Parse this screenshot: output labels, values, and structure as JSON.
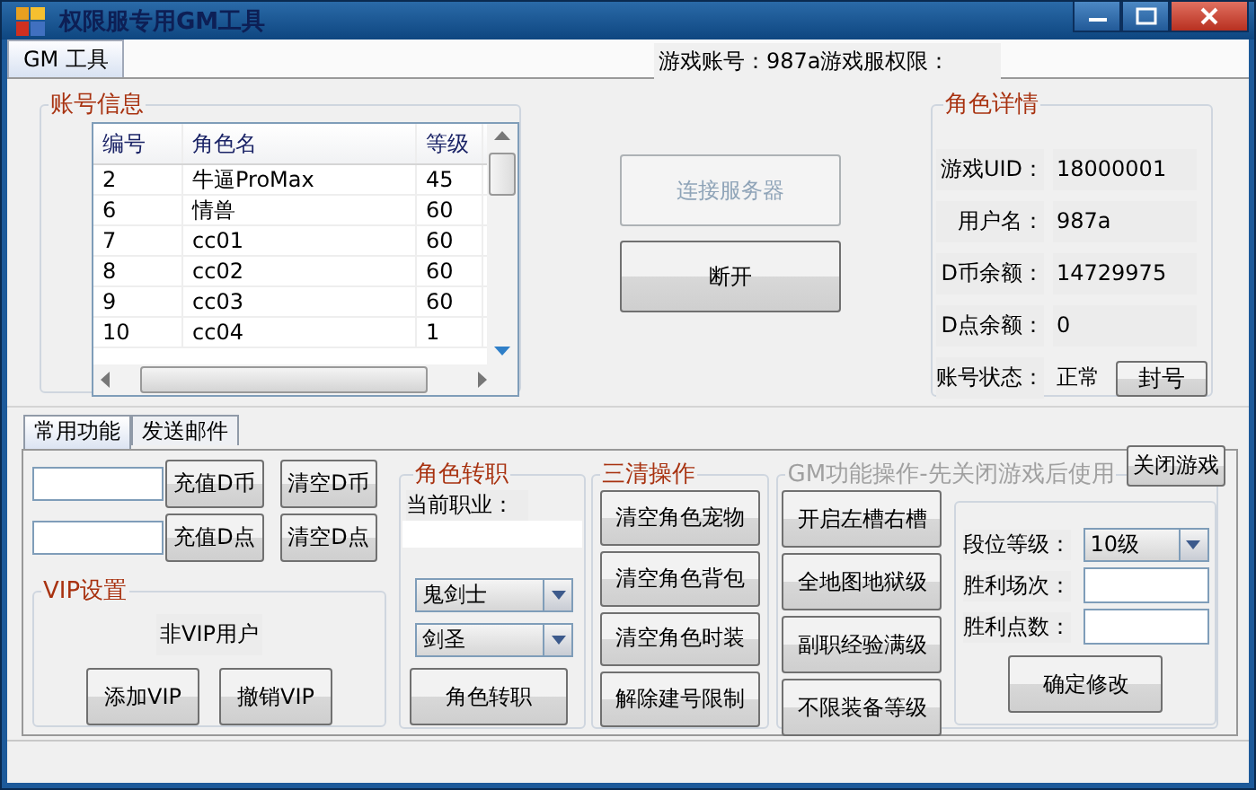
{
  "window": {
    "title": "权限服专用GM工具"
  },
  "menu": [
    {
      "label": "GM 工具",
      "selected": true
    }
  ],
  "header_info": "游戏账号：987a游戏服权限：",
  "account_info": {
    "title": "账号信息",
    "columns": [
      "编号",
      "角色名",
      "等级"
    ],
    "rows": [
      [
        "2",
        "牛逼ProMax",
        "45"
      ],
      [
        "6",
        "情兽",
        "60"
      ],
      [
        "7",
        "cc01",
        "60"
      ],
      [
        "8",
        "cc02",
        "60"
      ],
      [
        "9",
        "cc03",
        "60"
      ],
      [
        "10",
        "cc04",
        "1"
      ]
    ]
  },
  "connection_buttons": [
    {
      "label": "连接服务器",
      "disabled": true
    },
    {
      "label": "断开",
      "disabled": false
    }
  ],
  "role_details": {
    "title": "角色详情",
    "fields": [
      {
        "label": "游戏UID：",
        "value": "18000001"
      },
      {
        "label": "用户名：",
        "value": "987a"
      },
      {
        "label": "D币余额：",
        "value": "14729975"
      },
      {
        "label": "D点余额：",
        "value": "0"
      }
    ],
    "status": {
      "label": "账号状态：",
      "value": "正常",
      "button": "封号"
    }
  },
  "tabs": [
    {
      "label": "常用功能",
      "selected": true
    },
    {
      "label": "发送邮件",
      "selected": false
    }
  ],
  "recharge_rows": [
    {
      "buttons": [
        "充值D币",
        "清空D币"
      ]
    },
    {
      "buttons": [
        "充值D点",
        "清空D点"
      ]
    }
  ],
  "vip": {
    "title": "VIP设置",
    "status": "非VIP用户",
    "buttons": [
      "添加VIP",
      "撤销VIP"
    ]
  },
  "job_change": {
    "title": "角色转职",
    "current_label": "当前职业：",
    "selects": [
      "鬼剑士",
      "剑圣"
    ],
    "button": "角色转职"
  },
  "clear_ops": {
    "title": "三清操作",
    "buttons": [
      "清空角色宠物",
      "清空角色背包",
      "清空角色时装",
      "解除建号限制"
    ]
  },
  "gm_ops": {
    "title": "GM功能操作-先关闭游戏后使用",
    "disabled": true,
    "close_button": "关闭游戏",
    "buttons": [
      "开启左槽右槽",
      "全地图地狱级",
      "副职经验满级",
      "不限装备等级"
    ],
    "rank": {
      "label": "段位等级：",
      "value": "10级"
    },
    "fields": [
      {
        "label": "胜利场次："
      },
      {
        "label": "胜利点数："
      }
    ],
    "confirm": "确定修改"
  }
}
